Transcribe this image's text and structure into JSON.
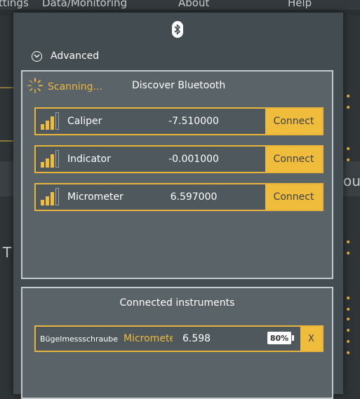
{
  "menubar": {
    "items": [
      "ttings",
      "Data/Monitoring",
      "About",
      "Help"
    ]
  },
  "background": {
    "deco_text_right": "ous",
    "deco_text_left": "T"
  },
  "modal": {
    "icon": "bluetooth-icon",
    "advanced_label": "Advanced"
  },
  "discover": {
    "scanning_label": "Scanning...",
    "title": "Discover Bluetooth",
    "devices": [
      {
        "name": "Caliper",
        "value": "-7.510000",
        "signal_bars": 3,
        "connect_label": "Connect"
      },
      {
        "name": "Indicator",
        "value": "-0.001000",
        "signal_bars": 3,
        "connect_label": "Connect"
      },
      {
        "name": "Micrometer",
        "value": "6.597000",
        "signal_bars": 3,
        "connect_label": "Connect"
      }
    ]
  },
  "connected": {
    "title": "Connected instruments",
    "instruments": [
      {
        "name": "Bügelmessschraube",
        "type": "Micrometer",
        "value": "6.598",
        "battery": "80%",
        "remove_label": "X"
      }
    ]
  },
  "colors": {
    "accent": "#efbc3c",
    "panel_border": "#c5cacc",
    "modal_bg": "#434c50"
  }
}
